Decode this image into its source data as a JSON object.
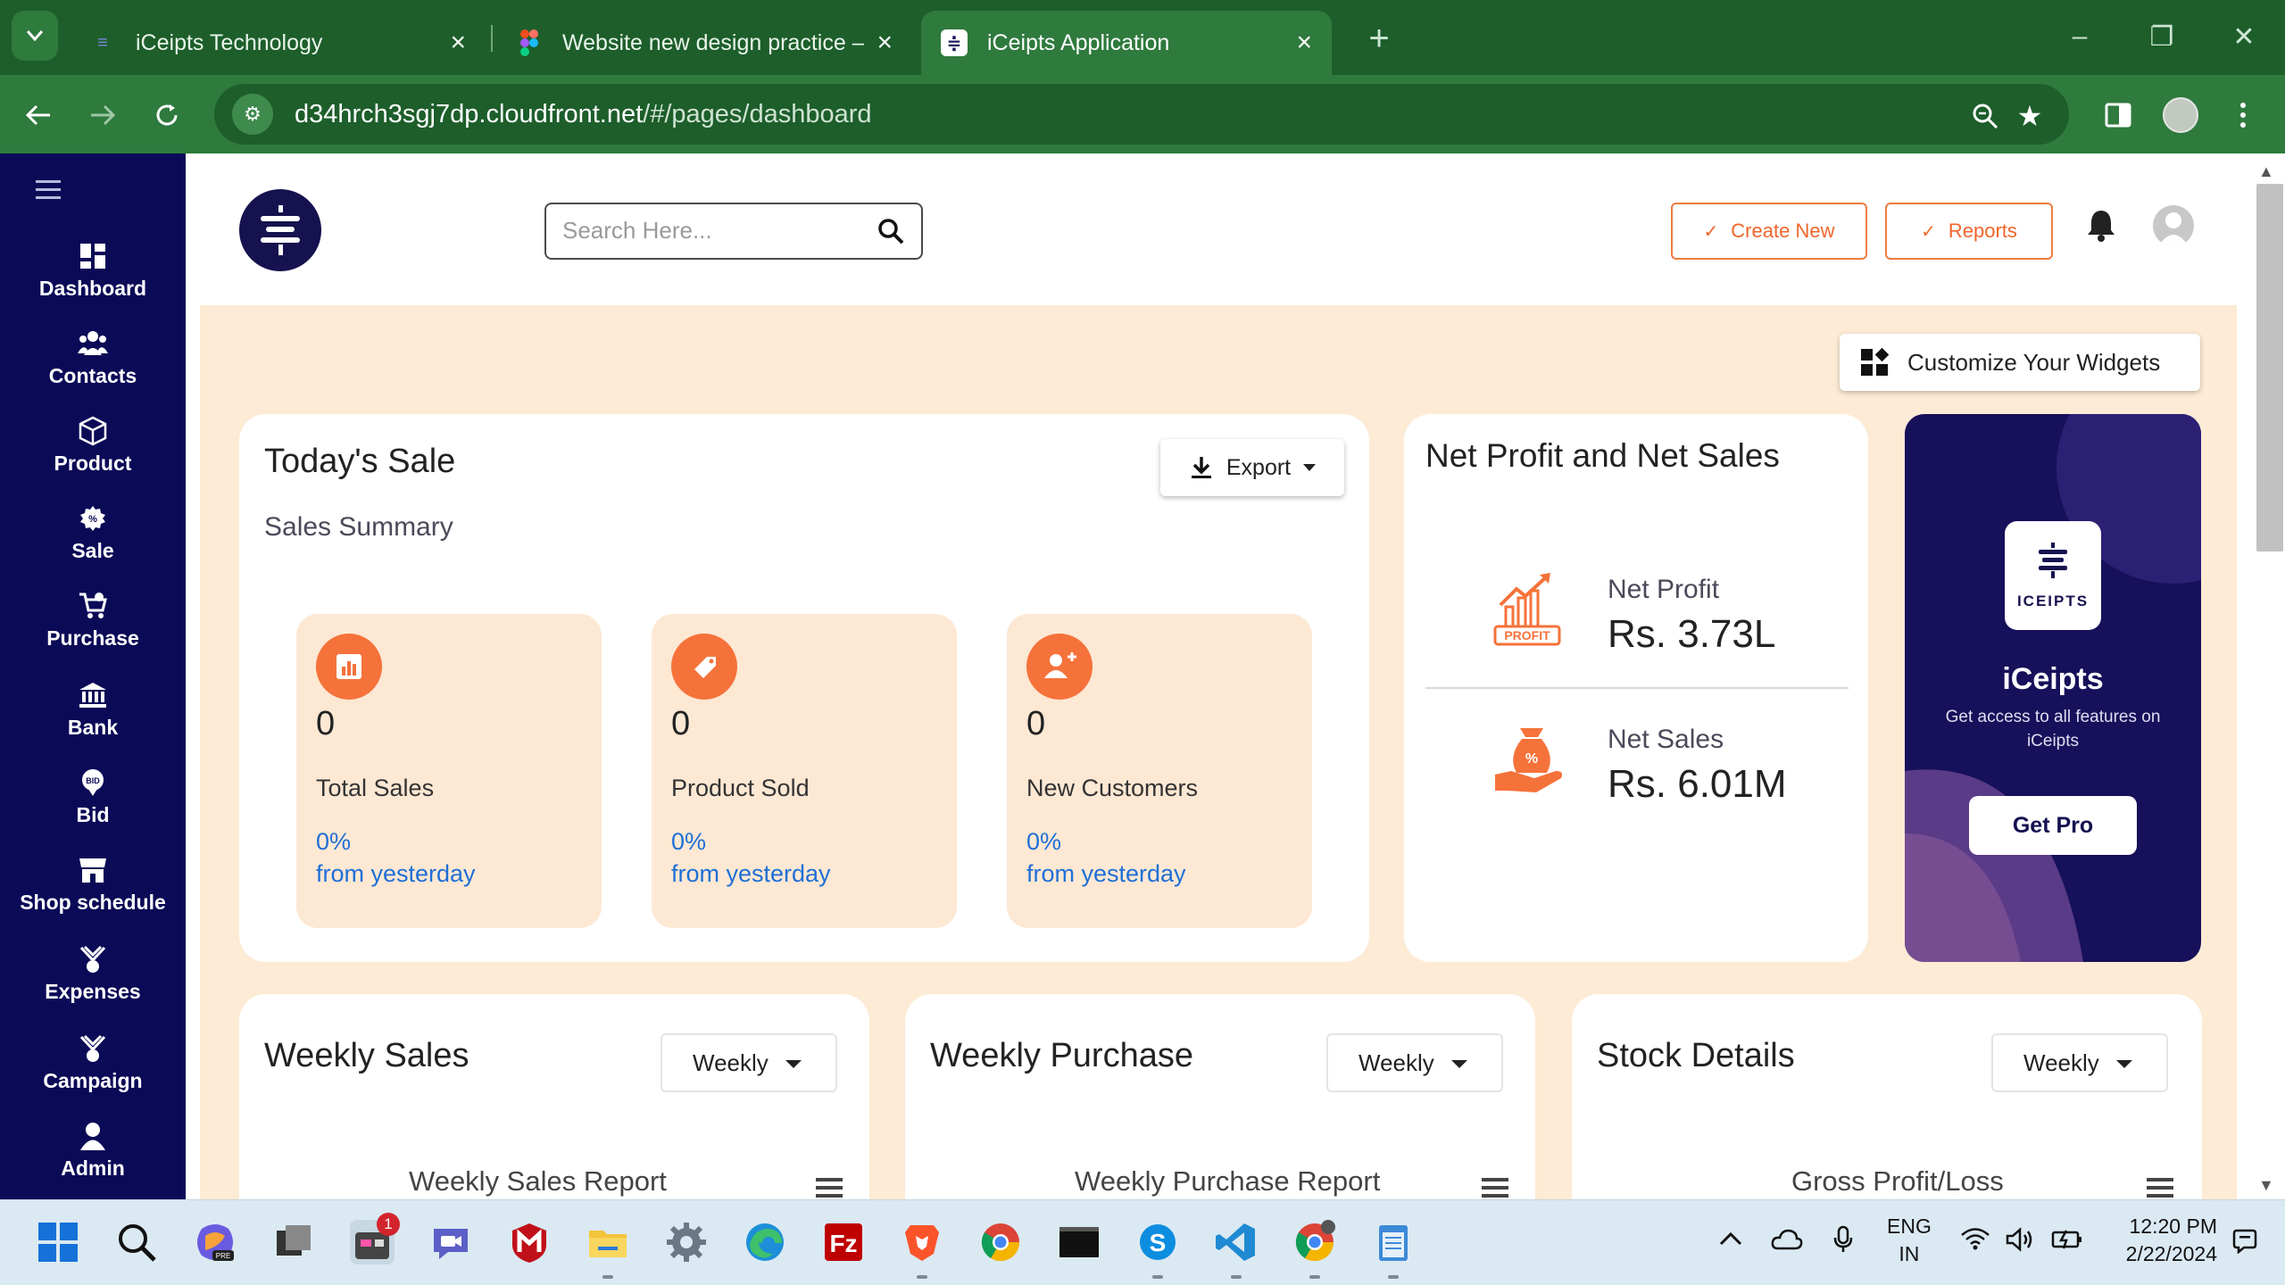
{
  "browser": {
    "tabs": [
      {
        "title": "iCeipts Technology",
        "active": false
      },
      {
        "title": "Website new design practice – I",
        "active": false
      },
      {
        "title": "iCeipts Application",
        "active": true
      }
    ],
    "url_host": "d34hrch3sgj7dp.cloudfront.net",
    "url_path": "/#/pages/dashboard"
  },
  "sidebar": {
    "items": [
      {
        "label": "Dashboard",
        "icon": "dashboard-icon"
      },
      {
        "label": "Contacts",
        "icon": "contacts-icon"
      },
      {
        "label": "Product",
        "icon": "product-icon"
      },
      {
        "label": "Sale",
        "icon": "sale-icon"
      },
      {
        "label": "Purchase",
        "icon": "purchase-icon"
      },
      {
        "label": "Bank",
        "icon": "bank-icon"
      },
      {
        "label": "Bid",
        "icon": "bid-icon"
      },
      {
        "label": "Shop schedule",
        "icon": "shop-icon"
      },
      {
        "label": "Expenses",
        "icon": "expenses-icon"
      },
      {
        "label": "Campaign",
        "icon": "campaign-icon"
      },
      {
        "label": "Admin",
        "icon": "admin-icon"
      }
    ]
  },
  "header": {
    "search_placeholder": "Search Here...",
    "create_new_label": "Create New",
    "reports_label": "Reports"
  },
  "colors": {
    "accent": "#f5723a",
    "sidebar_bg": "#0b0a57",
    "content_bg": "#fdebd5",
    "link_blue": "#1f6fd6"
  },
  "main": {
    "customize_label": "Customize Your Widgets",
    "todays_sale": {
      "title": "Today's Sale",
      "subtitle": "Sales Summary",
      "export_label": "Export",
      "stats": [
        {
          "value": "0",
          "label": "Total Sales",
          "percent": "0%",
          "from": "from yesterday",
          "icon": "bar-chart-icon"
        },
        {
          "value": "0",
          "label": "Product Sold",
          "percent": "0%",
          "from": "from yesterday",
          "icon": "tag-icon"
        },
        {
          "value": "0",
          "label": "New Customers",
          "percent": "0%",
          "from": "from yesterday",
          "icon": "add-user-icon"
        }
      ]
    },
    "net_profit": {
      "title": "Net Profit and Net Sales",
      "profit_label": "Net Profit",
      "profit_value": "Rs. 3.73L",
      "profit_badge": "PROFIT",
      "sales_label": "Net Sales",
      "sales_value": "Rs. 6.01M"
    },
    "promo": {
      "logo_text": "ICEIPTS",
      "title": "iCeipts",
      "description": "Get access to all features on iCeipts",
      "button": "Get Pro"
    },
    "weekly_sales": {
      "title": "Weekly Sales",
      "dropdown": "Weekly",
      "chart_title": "Weekly Sales Report"
    },
    "weekly_purchase": {
      "title": "Weekly Purchase",
      "dropdown": "Weekly",
      "chart_title": "Weekly Purchase Report"
    },
    "stock_details": {
      "title": "Stock Details",
      "dropdown": "Weekly",
      "chart_title": "Gross Profit/Loss"
    }
  },
  "taskbar": {
    "notification_badge": "1",
    "lang_top": "ENG",
    "lang_bottom": "IN",
    "time": "12:20 PM",
    "date": "2/22/2024"
  }
}
